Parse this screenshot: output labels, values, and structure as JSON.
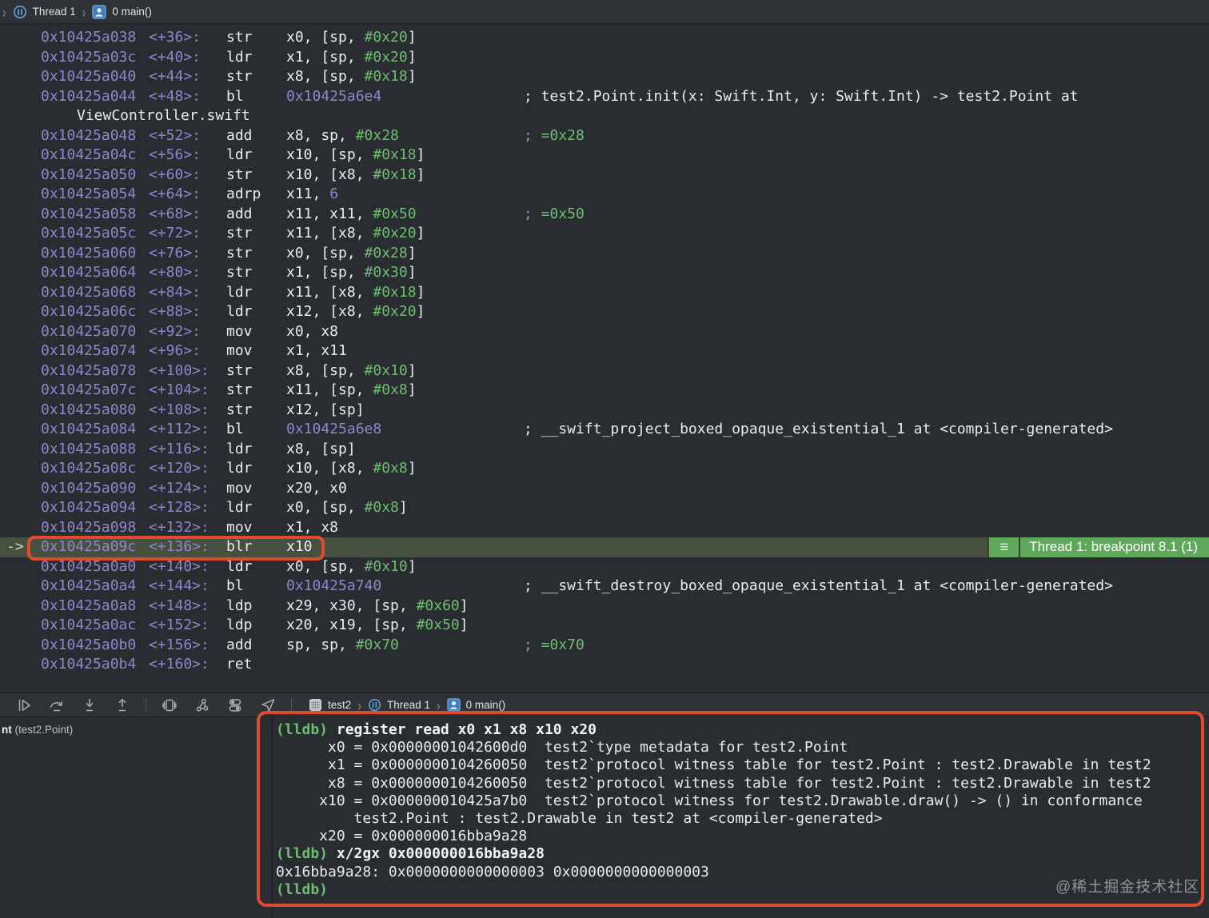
{
  "colors": {
    "background": "#292c31",
    "bar_background": "#2f3237",
    "address_purple": "#8e87cb",
    "immediate_green": "#70bd72",
    "plain_text": "#e9ebf0",
    "current_line_background": "#45513e",
    "breakpoint_badge_green": "#5fa75a",
    "annotation_red": "#e04b2e"
  },
  "top_jump_bar": {
    "thread": "Thread 1",
    "frame": "0 main()",
    "icons": [
      "chevron-icon",
      "paused-thread-icon",
      "stack-frame-person-icon"
    ]
  },
  "disassembly": {
    "current_marker": "->",
    "lines": [
      {
        "addr": "0x10425a038",
        "off": "<+36>:",
        "mnem": "str",
        "ops": [
          [
            "w",
            "x0, [sp, "
          ],
          [
            "g",
            "#0x20"
          ],
          [
            "w",
            "]"
          ]
        ],
        "comment": []
      },
      {
        "addr": "0x10425a03c",
        "off": "<+40>:",
        "mnem": "ldr",
        "ops": [
          [
            "w",
            "x1, [sp, "
          ],
          [
            "g",
            "#0x20"
          ],
          [
            "w",
            "]"
          ]
        ],
        "comment": []
      },
      {
        "addr": "0x10425a040",
        "off": "<+44>:",
        "mnem": "str",
        "ops": [
          [
            "w",
            "x8, [sp, "
          ],
          [
            "g",
            "#0x18"
          ],
          [
            "w",
            "]"
          ]
        ],
        "comment": []
      },
      {
        "addr": "0x10425a044",
        "off": "<+48>:",
        "mnem": "bl",
        "ops": [
          [
            "p",
            "0x10425a6e4"
          ]
        ],
        "comment": [
          [
            "w",
            "; test2.Point.init(x: Swift.Int, y: Swift.Int) -> test2.Point at"
          ]
        ]
      },
      {
        "wrap": "ViewController.swift"
      },
      {
        "addr": "0x10425a048",
        "off": "<+52>:",
        "mnem": "add",
        "ops": [
          [
            "w",
            "x8, sp, "
          ],
          [
            "g",
            "#0x28"
          ]
        ],
        "comment": [
          [
            "g",
            "; =0x28"
          ]
        ]
      },
      {
        "addr": "0x10425a04c",
        "off": "<+56>:",
        "mnem": "ldr",
        "ops": [
          [
            "w",
            "x10, [sp, "
          ],
          [
            "g",
            "#0x18"
          ],
          [
            "w",
            "]"
          ]
        ],
        "comment": []
      },
      {
        "addr": "0x10425a050",
        "off": "<+60>:",
        "mnem": "str",
        "ops": [
          [
            "w",
            "x10, [x8, "
          ],
          [
            "g",
            "#0x18"
          ],
          [
            "w",
            "]"
          ]
        ],
        "comment": []
      },
      {
        "addr": "0x10425a054",
        "off": "<+64>:",
        "mnem": "adrp",
        "ops": [
          [
            "w",
            "x11, "
          ],
          [
            "p",
            "6"
          ]
        ],
        "comment": []
      },
      {
        "addr": "0x10425a058",
        "off": "<+68>:",
        "mnem": "add",
        "ops": [
          [
            "w",
            "x11, x11, "
          ],
          [
            "g",
            "#0x50"
          ]
        ],
        "comment": [
          [
            "g",
            "; =0x50"
          ]
        ]
      },
      {
        "addr": "0x10425a05c",
        "off": "<+72>:",
        "mnem": "str",
        "ops": [
          [
            "w",
            "x11, [x8, "
          ],
          [
            "g",
            "#0x20"
          ],
          [
            "w",
            "]"
          ]
        ],
        "comment": []
      },
      {
        "addr": "0x10425a060",
        "off": "<+76>:",
        "mnem": "str",
        "ops": [
          [
            "w",
            "x0, [sp, "
          ],
          [
            "g",
            "#0x28"
          ],
          [
            "w",
            "]"
          ]
        ],
        "comment": []
      },
      {
        "addr": "0x10425a064",
        "off": "<+80>:",
        "mnem": "str",
        "ops": [
          [
            "w",
            "x1, [sp, "
          ],
          [
            "g",
            "#0x30"
          ],
          [
            "w",
            "]"
          ]
        ],
        "comment": []
      },
      {
        "addr": "0x10425a068",
        "off": "<+84>:",
        "mnem": "ldr",
        "ops": [
          [
            "w",
            "x11, [x8, "
          ],
          [
            "g",
            "#0x18"
          ],
          [
            "w",
            "]"
          ]
        ],
        "comment": []
      },
      {
        "addr": "0x10425a06c",
        "off": "<+88>:",
        "mnem": "ldr",
        "ops": [
          [
            "w",
            "x12, [x8, "
          ],
          [
            "g",
            "#0x20"
          ],
          [
            "w",
            "]"
          ]
        ],
        "comment": []
      },
      {
        "addr": "0x10425a070",
        "off": "<+92>:",
        "mnem": "mov",
        "ops": [
          [
            "w",
            "x0, x8"
          ]
        ],
        "comment": []
      },
      {
        "addr": "0x10425a074",
        "off": "<+96>:",
        "mnem": "mov",
        "ops": [
          [
            "w",
            "x1, x11"
          ]
        ],
        "comment": []
      },
      {
        "addr": "0x10425a078",
        "off": "<+100>:",
        "mnem": "str",
        "ops": [
          [
            "w",
            "x8, [sp, "
          ],
          [
            "g",
            "#0x10"
          ],
          [
            "w",
            "]"
          ]
        ],
        "comment": []
      },
      {
        "addr": "0x10425a07c",
        "off": "<+104>:",
        "mnem": "str",
        "ops": [
          [
            "w",
            "x11, [sp, "
          ],
          [
            "g",
            "#0x8"
          ],
          [
            "w",
            "]"
          ]
        ],
        "comment": []
      },
      {
        "addr": "0x10425a080",
        "off": "<+108>:",
        "mnem": "str",
        "ops": [
          [
            "w",
            "x12, [sp]"
          ]
        ],
        "comment": []
      },
      {
        "addr": "0x10425a084",
        "off": "<+112>:",
        "mnem": "bl",
        "ops": [
          [
            "p",
            "0x10425a6e8"
          ]
        ],
        "comment": [
          [
            "w",
            "; __swift_project_boxed_opaque_existential_1 at <compiler-generated>"
          ]
        ]
      },
      {
        "addr": "0x10425a088",
        "off": "<+116>:",
        "mnem": "ldr",
        "ops": [
          [
            "w",
            "x8, [sp]"
          ]
        ],
        "comment": []
      },
      {
        "addr": "0x10425a08c",
        "off": "<+120>:",
        "mnem": "ldr",
        "ops": [
          [
            "w",
            "x10, [x8, "
          ],
          [
            "g",
            "#0x8"
          ],
          [
            "w",
            "]"
          ]
        ],
        "comment": []
      },
      {
        "addr": "0x10425a090",
        "off": "<+124>:",
        "mnem": "mov",
        "ops": [
          [
            "w",
            "x20, x0"
          ]
        ],
        "comment": []
      },
      {
        "addr": "0x10425a094",
        "off": "<+128>:",
        "mnem": "ldr",
        "ops": [
          [
            "w",
            "x0, [sp, "
          ],
          [
            "g",
            "#0x8"
          ],
          [
            "w",
            "]"
          ]
        ],
        "comment": []
      },
      {
        "addr": "0x10425a098",
        "off": "<+132>:",
        "mnem": "mov",
        "ops": [
          [
            "w",
            "x1, x8"
          ]
        ],
        "comment": []
      },
      {
        "addr": "0x10425a09c",
        "off": "<+136>:",
        "mnem": "blr",
        "ops": [
          [
            "w",
            "x10"
          ]
        ],
        "comment": [],
        "current": true
      },
      {
        "addr": "0x10425a0a0",
        "off": "<+140>:",
        "mnem": "ldr",
        "ops": [
          [
            "w",
            "x0, [sp, "
          ],
          [
            "g",
            "#0x10"
          ],
          [
            "w",
            "]"
          ]
        ],
        "comment": []
      },
      {
        "addr": "0x10425a0a4",
        "off": "<+144>:",
        "mnem": "bl",
        "ops": [
          [
            "p",
            "0x10425a740"
          ]
        ],
        "comment": [
          [
            "w",
            "; __swift_destroy_boxed_opaque_existential_1 at <compiler-generated>"
          ]
        ]
      },
      {
        "addr": "0x10425a0a8",
        "off": "<+148>:",
        "mnem": "ldp",
        "ops": [
          [
            "w",
            "x29, x30, [sp, "
          ],
          [
            "g",
            "#0x60"
          ],
          [
            "w",
            "]"
          ]
        ],
        "comment": []
      },
      {
        "addr": "0x10425a0ac",
        "off": "<+152>:",
        "mnem": "ldp",
        "ops": [
          [
            "w",
            "x20, x19, [sp, "
          ],
          [
            "g",
            "#0x50"
          ],
          [
            "w",
            "]"
          ]
        ],
        "comment": []
      },
      {
        "addr": "0x10425a0b0",
        "off": "<+156>:",
        "mnem": "add",
        "ops": [
          [
            "w",
            "sp, sp, "
          ],
          [
            "g",
            "#0x70"
          ]
        ],
        "comment": [
          [
            "g",
            "; =0x70"
          ]
        ]
      },
      {
        "addr": "0x10425a0b4",
        "off": "<+160>:",
        "mnem": "ret",
        "ops": [],
        "comment": []
      }
    ]
  },
  "breakpoint_badge": {
    "menu_glyph": "≡",
    "label": "Thread 1: breakpoint 8.1 (1)"
  },
  "debug_toolbar": {
    "icons": [
      "continue-icon",
      "step-over-icon",
      "step-into-icon",
      "step-out-icon",
      "view-hierarchy-icon",
      "memory-graph-icon",
      "environment-overrides-icon",
      "simulate-location-icon"
    ],
    "breadcrumb": {
      "app": "test2",
      "thread": "Thread 1",
      "frame": "0 main()"
    }
  },
  "variables_panel": {
    "visible_name": "nt",
    "visible_type": "(test2.Point)"
  },
  "console": {
    "lines": [
      [
        [
          "p",
          "(lldb) "
        ],
        [
          "c",
          "register read x0 x1 x8 x10 x20"
        ]
      ],
      [
        [
          "o",
          "      x0 = 0x00000001042600d0  test2`type metadata for test2.Point"
        ]
      ],
      [
        [
          "o",
          "      x1 = 0x0000000104260050  test2`protocol witness table for test2.Point : test2.Drawable in test2"
        ]
      ],
      [
        [
          "o",
          "      x8 = 0x0000000104260050  test2`protocol witness table for test2.Point : test2.Drawable in test2"
        ]
      ],
      [
        [
          "o",
          "     x10 = 0x000000010425a7b0  test2`protocol witness for test2.Drawable.draw() -> () in conformance"
        ]
      ],
      [
        [
          "o",
          "         test2.Point : test2.Drawable in test2 at <compiler-generated>"
        ]
      ],
      [
        [
          "o",
          "     x20 = 0x000000016bba9a28"
        ]
      ],
      [
        [
          "p",
          "(lldb) "
        ],
        [
          "c",
          "x/2gx 0x000000016bba9a28"
        ]
      ],
      [
        [
          "o",
          "0x16bba9a28: 0x0000000000000003 0x0000000000000003"
        ]
      ],
      [
        [
          "p",
          "(lldb)"
        ]
      ]
    ]
  },
  "watermark": "@稀土掘金技术社区"
}
